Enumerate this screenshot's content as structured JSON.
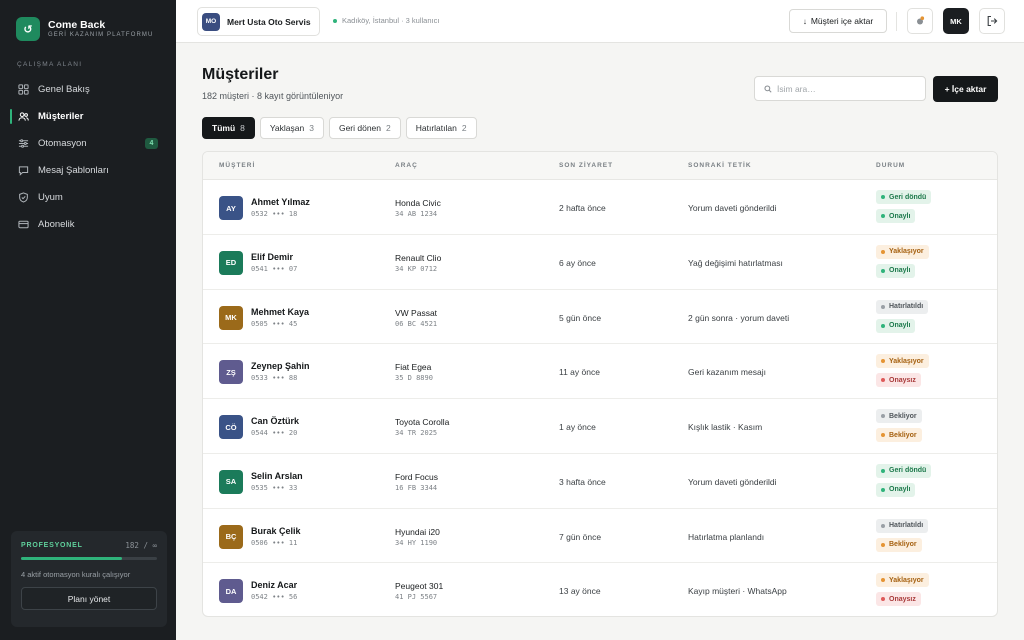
{
  "brand": {
    "logo": "↺",
    "name": "Come Back",
    "subtitle": "GERİ KAZANIM PLATFORMU"
  },
  "sidebar": {
    "section_label": "ÇALIŞMA ALANI",
    "items": [
      {
        "label": "Genel Bakış",
        "icon": "grid-icon"
      },
      {
        "label": "Müşteriler",
        "icon": "users-icon",
        "active": true
      },
      {
        "label": "Otomasyon",
        "icon": "sliders-icon",
        "badge": "4"
      },
      {
        "label": "Mesaj Şablonları",
        "icon": "message-icon"
      },
      {
        "label": "Uyum",
        "icon": "shield-icon"
      },
      {
        "label": "Abonelik",
        "icon": "card-icon"
      }
    ],
    "plan": {
      "name": "PROFESYONEL",
      "count": "182 / ∞",
      "description": "4 aktif otomasyon kuralı çalışıyor",
      "button": "Planı yönet"
    }
  },
  "topbar": {
    "workspace_initials": "MO",
    "workspace_name": "Mert Usta Oto Servis",
    "workspace_meta": "Kadıköy, İstanbul · 3 kullanıcı",
    "import_label": "Müşteri içe aktar",
    "user_initials": "MK"
  },
  "main": {
    "title": "Müşteriler",
    "subtitle": "182 müşteri · 8 kayıt görüntüleniyor",
    "search_placeholder": "İsim ara…",
    "import_button": "+ İçe aktar",
    "tabs": [
      {
        "label": "Tümü",
        "count": "8",
        "active": true
      },
      {
        "label": "Yaklaşan",
        "count": "3"
      },
      {
        "label": "Geri dönen",
        "count": "2"
      },
      {
        "label": "Hatırlatılan",
        "count": "2"
      }
    ],
    "columns": [
      "MÜŞTERİ",
      "ARAÇ",
      "SON ZİYARET",
      "SONRAKİ TETİK",
      "DURUM"
    ],
    "rows": [
      {
        "initials": "AY",
        "color": "#3a5387",
        "name": "Ahmet Yılmaz",
        "phone": "0532 ••• 18",
        "car": "Honda Civic",
        "plate": "34 AB 1234",
        "visit": "2 hafta önce",
        "trigger": "Yorum daveti gönderildi",
        "status": [
          {
            "text": "Geri döndü",
            "tone": "green"
          },
          {
            "text": "Onaylı",
            "tone": "green"
          }
        ]
      },
      {
        "initials": "ED",
        "color": "#1b7b5a",
        "name": "Elif Demir",
        "phone": "0541 ••• 07",
        "car": "Renault Clio",
        "plate": "34 KP 0712",
        "visit": "6 ay önce",
        "trigger": "Yağ değişimi hatırlatması",
        "status": [
          {
            "text": "Yaklaşıyor",
            "tone": "orange"
          },
          {
            "text": "Onaylı",
            "tone": "green"
          }
        ]
      },
      {
        "initials": "MK",
        "color": "#9b6a1a",
        "name": "Mehmet Kaya",
        "phone": "0505 ••• 45",
        "car": "VW Passat",
        "plate": "06 BC 4521",
        "visit": "5 gün önce",
        "trigger": "2 gün sonra · yorum daveti",
        "status": [
          {
            "text": "Hatırlatıldı",
            "tone": "gray"
          },
          {
            "text": "Onaylı",
            "tone": "green"
          }
        ]
      },
      {
        "initials": "ZŞ",
        "color": "#5f5b8f",
        "name": "Zeynep Şahin",
        "phone": "0533 ••• 88",
        "car": "Fiat Egea",
        "plate": "35 D 8890",
        "visit": "11 ay önce",
        "trigger": "Geri kazanım mesajı",
        "status": [
          {
            "text": "Yaklaşıyor",
            "tone": "orange"
          },
          {
            "text": "Onaysız",
            "tone": "red"
          }
        ]
      },
      {
        "initials": "CÖ",
        "color": "#3a5387",
        "name": "Can Öztürk",
        "phone": "0544 ••• 20",
        "car": "Toyota Corolla",
        "plate": "34 TR 2025",
        "visit": "1 ay önce",
        "trigger": "Kışlık lastik · Kasım",
        "status": [
          {
            "text": "Bekliyor",
            "tone": "gray"
          },
          {
            "text": "Bekliyor",
            "tone": "orange"
          }
        ]
      },
      {
        "initials": "SA",
        "color": "#1b7b5a",
        "name": "Selin Arslan",
        "phone": "0535 ••• 33",
        "car": "Ford Focus",
        "plate": "16 FB 3344",
        "visit": "3 hafta önce",
        "trigger": "Yorum daveti gönderildi",
        "status": [
          {
            "text": "Geri döndü",
            "tone": "green"
          },
          {
            "text": "Onaylı",
            "tone": "green"
          }
        ]
      },
      {
        "initials": "BÇ",
        "color": "#9b6a1a",
        "name": "Burak Çelik",
        "phone": "0506 ••• 11",
        "car": "Hyundai i20",
        "plate": "34 HY 1190",
        "visit": "7 gün önce",
        "trigger": "Hatırlatma planlandı",
        "status": [
          {
            "text": "Hatırlatıldı",
            "tone": "gray"
          },
          {
            "text": "Bekliyor",
            "tone": "orange"
          }
        ]
      },
      {
        "initials": "DA",
        "color": "#5f5b8f",
        "name": "Deniz Acar",
        "phone": "0542 ••• 56",
        "car": "Peugeot 301",
        "plate": "41 PJ 5567",
        "visit": "13 ay önce",
        "trigger": "Kayıp müşteri · WhatsApp",
        "status": [
          {
            "text": "Yaklaşıyor",
            "tone": "orange"
          },
          {
            "text": "Onaysız",
            "tone": "red"
          }
        ]
      }
    ]
  }
}
